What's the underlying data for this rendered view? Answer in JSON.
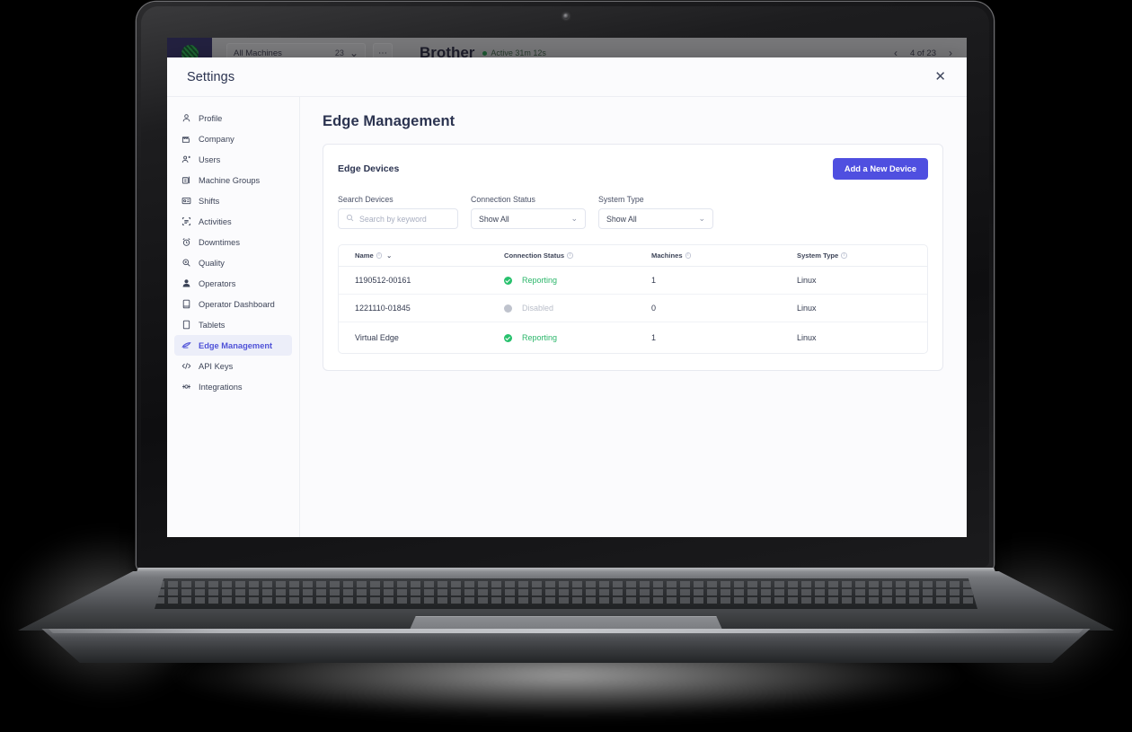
{
  "app": {
    "machine_filter": "All Machines",
    "machine_count": "23",
    "more_label": "⋯",
    "machine_name": "Brother",
    "machine_state": "Active 31m 12s",
    "pager": "4 of 23",
    "prev_icon": "‹",
    "next_icon": "›"
  },
  "modal": {
    "title": "Settings",
    "close_icon": "✕"
  },
  "sidebar": {
    "items": [
      {
        "label": "Profile",
        "icon": "user-icon",
        "active": false
      },
      {
        "label": "Company",
        "icon": "building-icon",
        "active": false
      },
      {
        "label": "Users",
        "icon": "users-icon",
        "active": false
      },
      {
        "label": "Machine Groups",
        "icon": "machine-groups-icon",
        "active": false
      },
      {
        "label": "Shifts",
        "icon": "badge-icon",
        "active": false
      },
      {
        "label": "Activities",
        "icon": "activities-icon",
        "active": false
      },
      {
        "label": "Downtimes",
        "icon": "alarm-clock-icon",
        "active": false
      },
      {
        "label": "Quality",
        "icon": "magnifier-icon",
        "active": false
      },
      {
        "label": "Operators",
        "icon": "operator-icon",
        "active": false
      },
      {
        "label": "Operator Dashboard",
        "icon": "dashboard-icon",
        "active": false
      },
      {
        "label": "Tablets",
        "icon": "tablet-icon",
        "active": false
      },
      {
        "label": "Edge Management",
        "icon": "edge-icon",
        "active": true
      },
      {
        "label": "API Keys",
        "icon": "code-icon",
        "active": false
      },
      {
        "label": "Integrations",
        "icon": "integrations-icon",
        "active": false
      }
    ]
  },
  "page": {
    "title": "Edge Management",
    "card_title": "Edge Devices",
    "add_button": "Add a New Device",
    "filters": {
      "search_label": "Search Devices",
      "search_value": "",
      "search_placeholder": "Search by keyword",
      "search_icon": "search-icon",
      "connection_label": "Connection Status",
      "connection_value": "Show All",
      "system_label": "System Type",
      "system_value": "Show All",
      "chevron_icon": "⌄"
    },
    "table": {
      "columns": [
        "Name",
        "Connection Status",
        "Machines",
        "System Type"
      ],
      "rows": [
        {
          "name": "1190512-00161",
          "status": "Reporting",
          "status_state": "ok",
          "machines": "1",
          "system": "Linux"
        },
        {
          "name": "1221110-01845",
          "status": "Disabled",
          "status_state": "off",
          "machines": "0",
          "system": "Linux"
        },
        {
          "name": "Virtual Edge",
          "status": "Reporting",
          "status_state": "ok",
          "machines": "1",
          "system": "Linux"
        }
      ]
    }
  },
  "colors": {
    "accent": "#4F4FE0",
    "status_ok": "#28C16D",
    "status_off": "#BFC3CD",
    "sidebar_active_bg": "#ECEEF9",
    "text": "#2B3350"
  }
}
